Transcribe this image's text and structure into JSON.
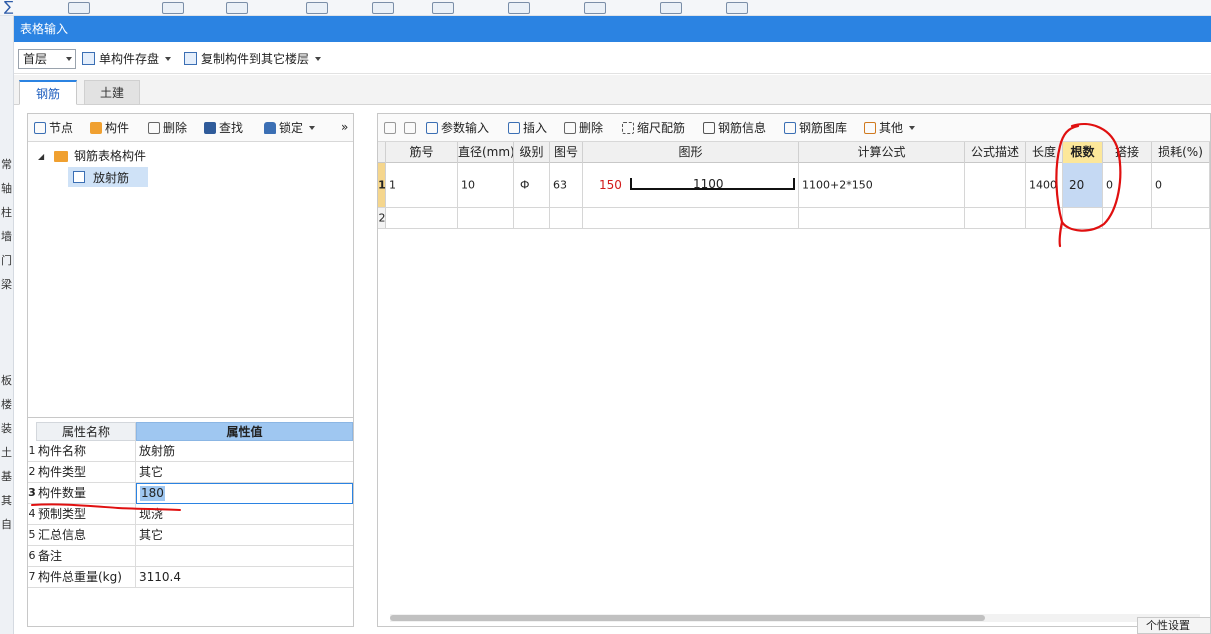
{
  "dialog": {
    "title": "表格输入"
  },
  "toolbar": {
    "floor": "首层",
    "save_single": "单构件存盘",
    "copy_to_floor": "复制构件到其它楼层"
  },
  "tabs": [
    {
      "label": "钢筋"
    },
    {
      "label": "土建"
    }
  ],
  "left_toolbar": {
    "node": "节点",
    "component": "构件",
    "delete": "删除",
    "find": "查找",
    "lock": "锁定",
    "more": "»"
  },
  "tree": {
    "root": "钢筋表格构件",
    "child": "放射筋",
    "toggle": "◢"
  },
  "properties": {
    "header_name": "属性名称",
    "header_value": "属性值",
    "rows": [
      {
        "idx": "1",
        "name": "构件名称",
        "value": "放射筋"
      },
      {
        "idx": "2",
        "name": "构件类型",
        "value": "其它"
      },
      {
        "idx": "3",
        "name": "构件数量",
        "value": "180"
      },
      {
        "idx": "4",
        "name": "预制类型",
        "value": "现浇"
      },
      {
        "idx": "5",
        "name": "汇总信息",
        "value": "其它"
      },
      {
        "idx": "6",
        "name": "备注",
        "value": ""
      },
      {
        "idx": "7",
        "name": "构件总重量(kg)",
        "value": "3110.4"
      }
    ]
  },
  "right_toolbar": {
    "param_input": "参数输入",
    "insert": "插入",
    "delete": "删除",
    "scale_rebar": "缩尺配筋",
    "rebar_info": "钢筋信息",
    "rebar_library": "钢筋图库",
    "other": "其他"
  },
  "grid": {
    "headers": [
      "筋号",
      "直径(mm)",
      "级别",
      "图号",
      "图形",
      "计算公式",
      "公式描述",
      "长度",
      "根数",
      "搭接",
      "损耗(%)"
    ],
    "rows": [
      {
        "num": "1",
        "bar_no": "1",
        "diameter": "10",
        "grade": "Ф",
        "shape_no": "63",
        "shape_left": "150",
        "shape_main": "1100",
        "formula": "1100+2*150",
        "formula_desc": "",
        "length": "1400",
        "count": "20",
        "lap": "0",
        "loss": "0"
      },
      {
        "num": "2"
      }
    ]
  },
  "background": {
    "left_chars": [
      "常",
      "轴",
      "柱",
      "墙",
      "门",
      "梁",
      "板",
      "楼",
      "装",
      "土",
      "基",
      "其",
      "自"
    ],
    "top_char": "∑"
  },
  "corner_button": "个性设置",
  "colors": {
    "accent": "#2b83e2",
    "selection": "#9fc7f1",
    "highlight_header": "#fce79a",
    "annotation": "#e01010"
  }
}
